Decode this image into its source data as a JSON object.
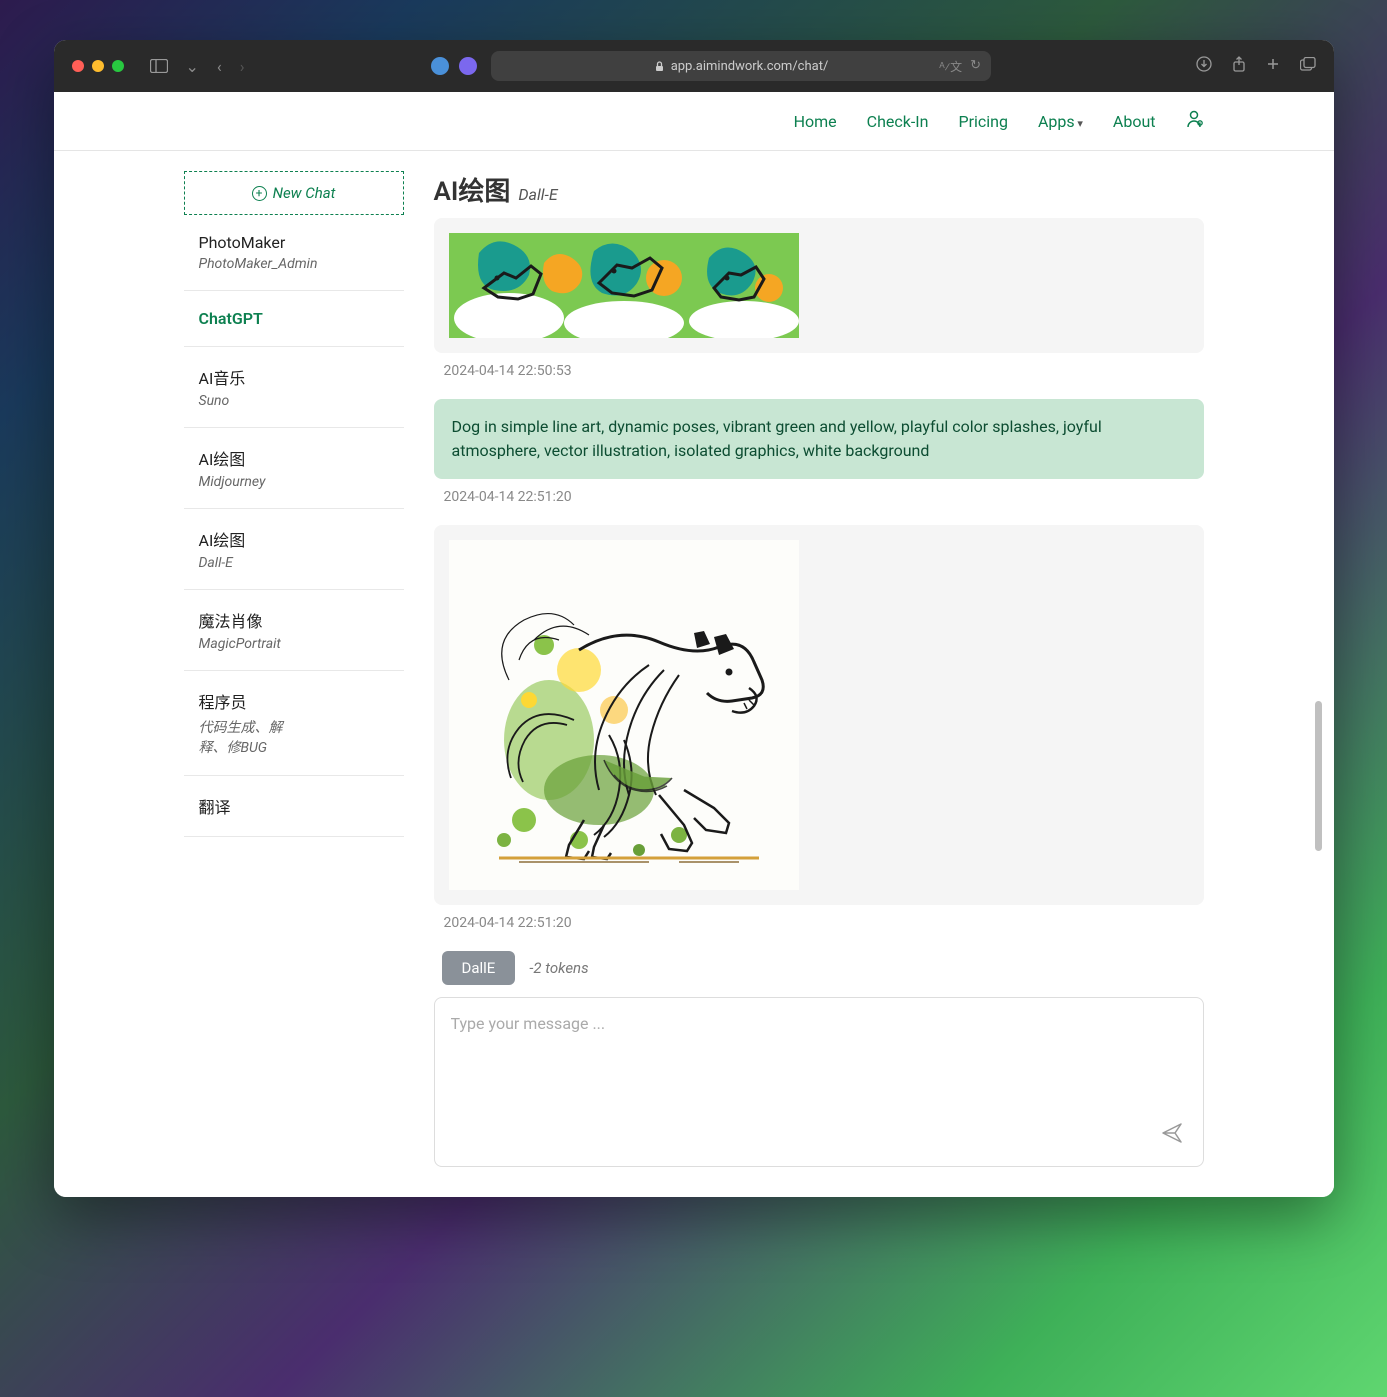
{
  "browser": {
    "url": "app.aimindwork.com/chat/"
  },
  "nav": {
    "home": "Home",
    "checkin": "Check-In",
    "pricing": "Pricing",
    "apps": "Apps",
    "about": "About"
  },
  "sidebar": {
    "new_chat": "New Chat",
    "items": [
      {
        "title": "PhotoMaker",
        "sub": "PhotoMaker_Admin"
      },
      {
        "title": "ChatGPT",
        "sub": ""
      },
      {
        "title": "AI音乐",
        "sub": "Suno"
      },
      {
        "title": "AI绘图",
        "sub": "Midjourney"
      },
      {
        "title": "AI绘图",
        "sub": "Dall-E"
      },
      {
        "title": "魔法肖像",
        "sub": "MagicPortrait"
      },
      {
        "title": "程序员",
        "sub": "代码生成、解释、修BUG"
      },
      {
        "title": "翻译",
        "sub": ""
      }
    ]
  },
  "chat": {
    "title": "AI绘图",
    "subtitle": "Dall-E",
    "messages": [
      {
        "type": "image",
        "timestamp": "2024-04-14 22:50:53"
      },
      {
        "type": "prompt",
        "text": "Dog in simple line art, dynamic poses, vibrant green and yellow, playful color splashes, joyful atmosphere, vector illustration, isolated graphics, white background",
        "timestamp": "2024-04-14 22:51:20"
      },
      {
        "type": "image",
        "timestamp": "2024-04-14 22:51:20"
      }
    ]
  },
  "input": {
    "model": "DallE",
    "tokens": "-2 tokens",
    "placeholder": "Type your message ..."
  }
}
